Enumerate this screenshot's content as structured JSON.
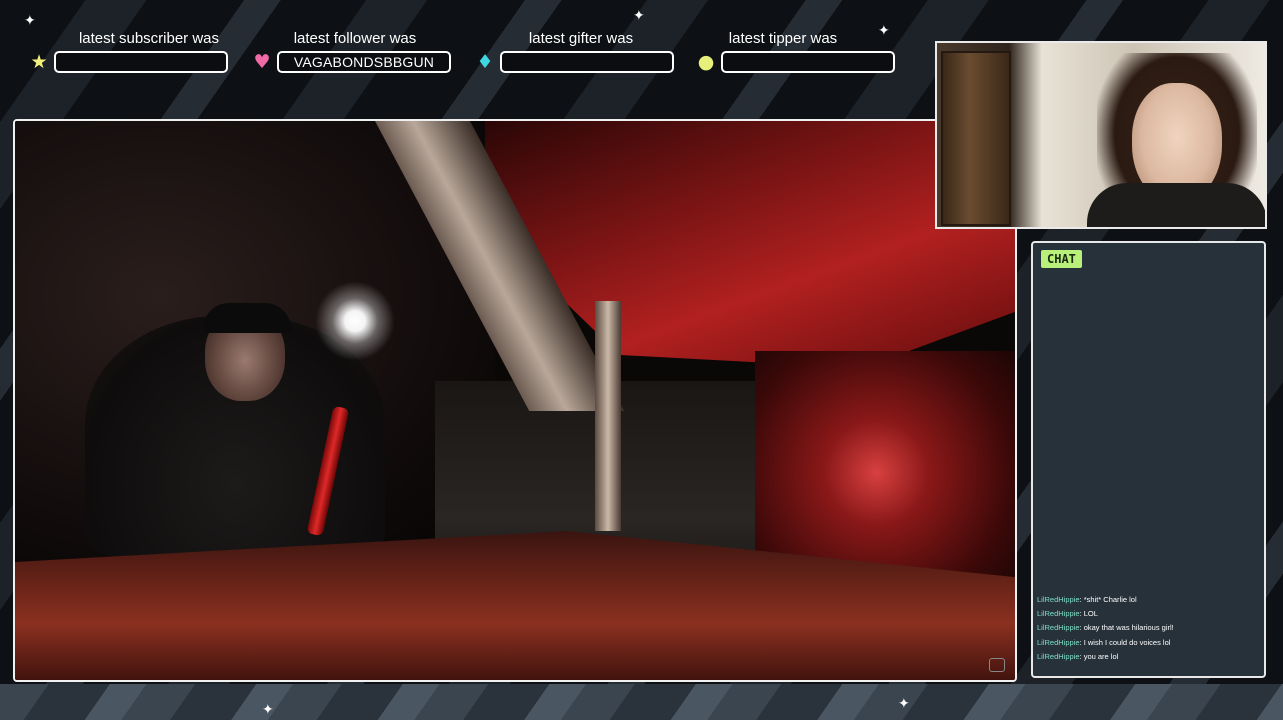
{
  "alerts": [
    {
      "title": "latest subscriber was",
      "value": "",
      "icon": "star-icon",
      "glyph": "★",
      "color": "#f2f07a"
    },
    {
      "title": "latest follower was",
      "value": "VAGABONDSBBGUN",
      "icon": "heart-icon",
      "glyph": "♥",
      "color": "#f06aa8"
    },
    {
      "title": "latest gifter was",
      "value": "",
      "icon": "diamond-icon",
      "glyph": "♦",
      "color": "#3fd8e0"
    },
    {
      "title": "latest tipper was",
      "value": "",
      "icon": "coin-icon",
      "glyph": "●",
      "color": "#e6f07a"
    }
  ],
  "chat": {
    "header": "CHAT",
    "messages": [
      {
        "user": "LilRedHippie",
        "text": " *shit* Charlie lol"
      },
      {
        "user": "LilRedHippie",
        "text": " LOL"
      },
      {
        "user": "LilRedHippie",
        "text": " okay that was hilarious girl!"
      },
      {
        "user": "LilRedHippie",
        "text": " I wish I could do voices lol"
      },
      {
        "user": "LilRedHippie",
        "text": " you are lol"
      }
    ]
  },
  "colors": {
    "frame_border": "#f0f0f0",
    "chat_bg": "#26313a",
    "chat_header_bg": "#b8f07a",
    "chat_username": "#7fe0c8"
  }
}
